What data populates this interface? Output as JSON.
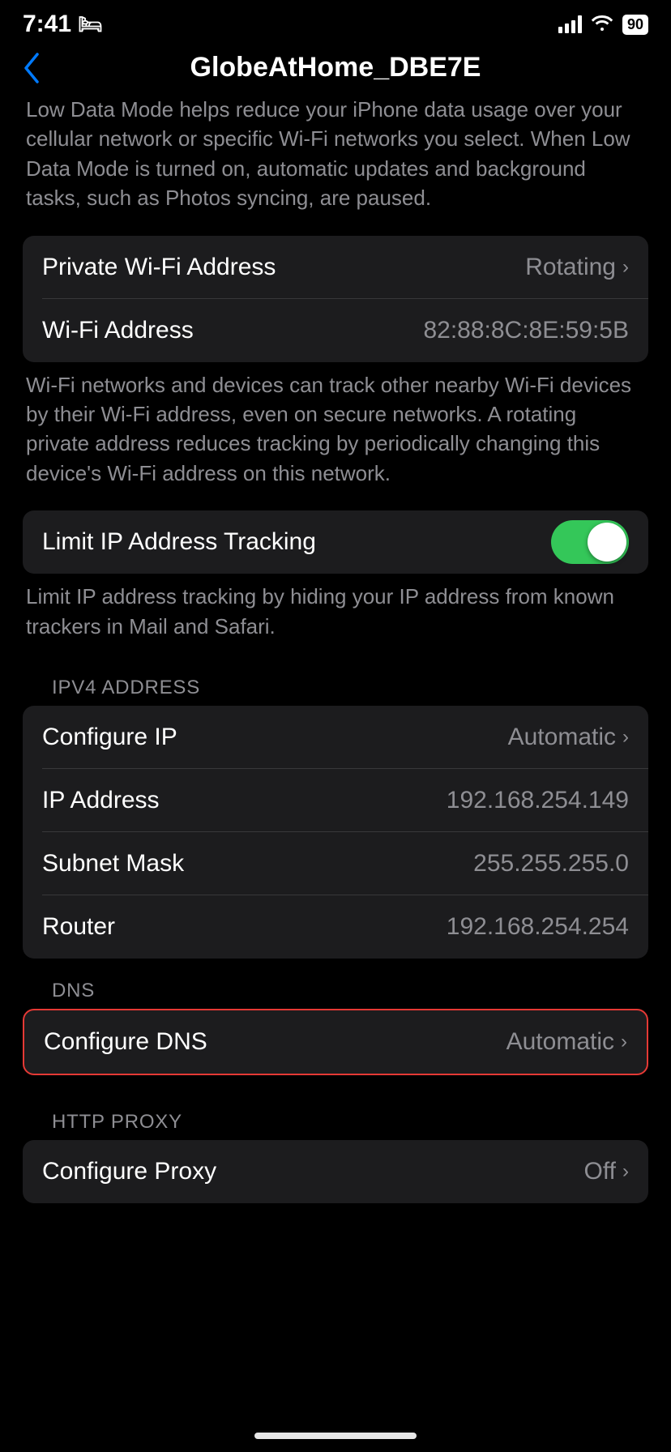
{
  "statusBar": {
    "time": "7:41",
    "battery": "90"
  },
  "header": {
    "backLabel": "‹",
    "title": "GlobeAtHome_DBE7E"
  },
  "lowDataDesc": "Low Data Mode helps reduce your iPhone data usage over your cellular network or specific Wi-Fi networks you select. When Low Data Mode is turned on, automatic updates and background tasks, such as Photos syncing, are paused.",
  "wifiGroup": {
    "rows": [
      {
        "label": "Private Wi-Fi Address",
        "value": "Rotating"
      },
      {
        "label": "Wi-Fi Address",
        "value": "82:88:8C:8E:59:5B"
      }
    ]
  },
  "wifiTrackDesc": "Wi-Fi networks and devices can track other nearby Wi-Fi devices by their Wi-Fi address, even on secure networks. A rotating private address reduces tracking by periodically changing this device's Wi-Fi address on this network.",
  "limitIPRow": {
    "label": "Limit IP Address Tracking",
    "toggleOn": true
  },
  "limitIPDesc": "Limit IP address tracking by hiding your IP address from known trackers in Mail and Safari.",
  "ipv4SectionLabel": "IPV4 ADDRESS",
  "ipv4Group": {
    "rows": [
      {
        "label": "Configure IP",
        "value": "Automatic"
      },
      {
        "label": "IP Address",
        "value": "192.168.254.149"
      },
      {
        "label": "Subnet Mask",
        "value": "255.255.255.0"
      },
      {
        "label": "Router",
        "value": "192.168.254.254"
      }
    ]
  },
  "dnsSectionLabel": "DNS",
  "dnsGroup": {
    "rows": [
      {
        "label": "Configure DNS",
        "value": "Automatic"
      }
    ]
  },
  "httpProxySectionLabel": "HTTP PROXY",
  "proxyGroup": {
    "rows": [
      {
        "label": "Configure Proxy",
        "value": "Off"
      }
    ]
  }
}
